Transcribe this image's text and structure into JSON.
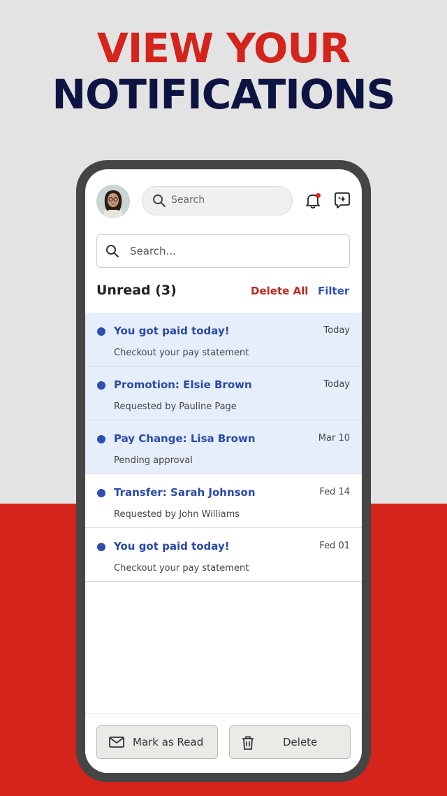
{
  "headline": {
    "line1": "VIEW YOUR",
    "line2": "NOTIFICATIONS"
  },
  "topbar": {
    "search_placeholder": "Search"
  },
  "search": {
    "placeholder": "Search..."
  },
  "section": {
    "title": "Unread (3)",
    "delete_all": "Delete All",
    "filter": "Filter"
  },
  "notifications": [
    {
      "title": "You got paid today!",
      "subtitle": "Checkout your pay statement",
      "date": "Today",
      "unread": true
    },
    {
      "title": "Promotion: Elsie Brown",
      "subtitle": "Requested by Pauline Page",
      "date": "Today",
      "unread": true
    },
    {
      "title": "Pay Change: Lisa Brown",
      "subtitle": "Pending approval",
      "date": "Mar 10",
      "unread": true
    },
    {
      "title": "Transfer: Sarah Johnson",
      "subtitle": "Requested by John Williams",
      "date": "Fed 14",
      "unread": false
    },
    {
      "title": "You got paid today!",
      "subtitle": "Checkout your pay statement",
      "date": "Fed 01",
      "unread": false
    }
  ],
  "actions": {
    "mark_read": "Mark as Read",
    "delete": "Delete"
  },
  "colors": {
    "brand_red": "#d4241c",
    "navy": "#0d1442",
    "accent_blue": "#2d4fb2",
    "unread_bg": "#e6eefb"
  }
}
